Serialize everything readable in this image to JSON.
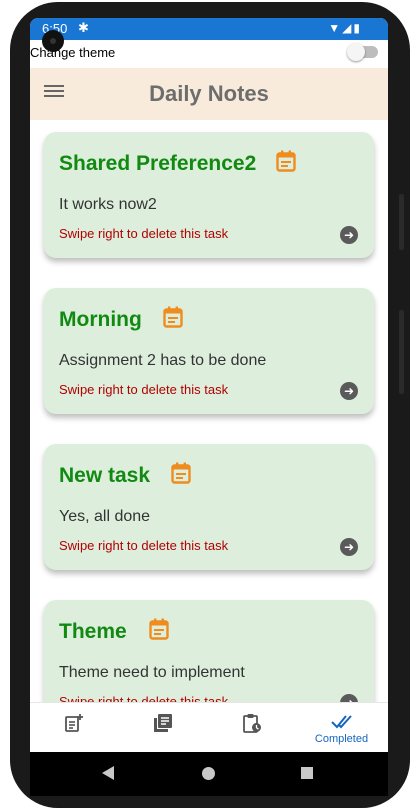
{
  "status_bar": {
    "time": "6:50",
    "gear_icon": "settings-icon",
    "indicators": "▼◢▮"
  },
  "theme_switch": {
    "label": "Change theme",
    "state": "off"
  },
  "app_bar": {
    "title": "Daily Notes",
    "menu_icon": "hamburger-menu-icon"
  },
  "tasks": [
    {
      "title": "Shared Preference2",
      "description": "It works now2",
      "hint": "Swipe right to delete this task"
    },
    {
      "title": "Morning",
      "description": "Assignment 2 has to be done",
      "hint": "Swipe right to delete this task"
    },
    {
      "title": "New task",
      "description": "Yes, all done",
      "hint": "Swipe right to delete this task"
    },
    {
      "title": "Theme",
      "description": "Theme need to implement",
      "hint": "Swipe right to delete this task"
    }
  ],
  "bottom_nav": {
    "items": [
      {
        "icon": "add-note-icon",
        "label": ""
      },
      {
        "icon": "library-books-icon",
        "label": ""
      },
      {
        "icon": "pending-clipboard-icon",
        "label": ""
      },
      {
        "icon": "done-all-icon",
        "label": "Completed"
      }
    ],
    "active_index": 3
  },
  "colors": {
    "status_bar": "#1976d2",
    "app_bar": "#f8ebdc",
    "card": "#ddeedd",
    "title_green": "#128a12",
    "swipe_hint_red": "#b30000",
    "calendar_orange": "#f08c1e",
    "nav_active_blue": "#1565c0"
  }
}
